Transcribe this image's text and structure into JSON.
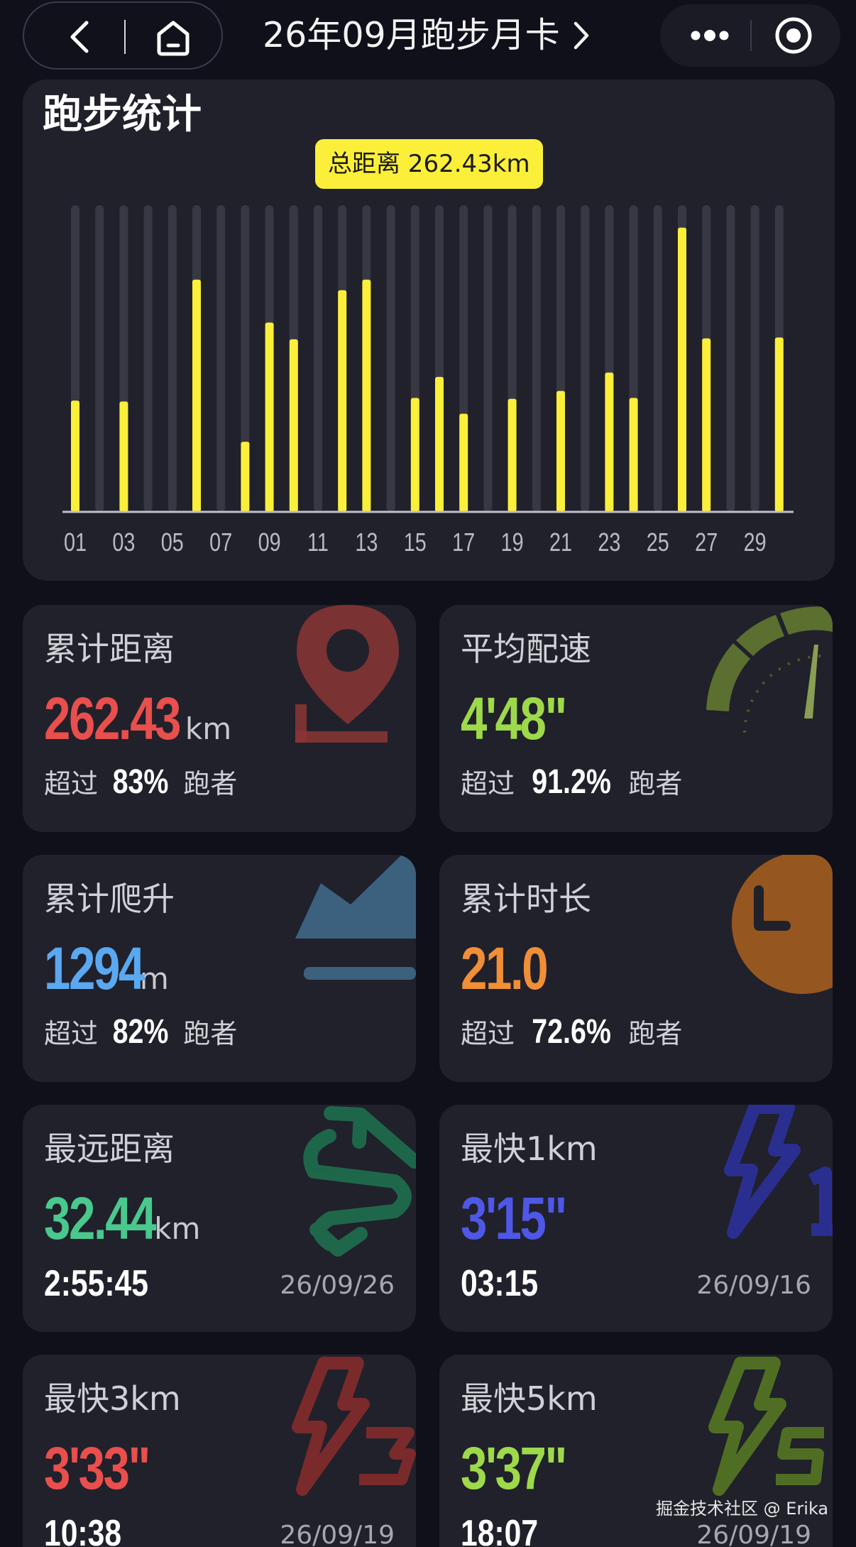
{
  "header": {
    "title": "26年09月跑步月卡",
    "back_icon": "chevron-left-icon",
    "home_icon": "home-icon",
    "more_icon": "more-dots-icon",
    "target_icon": "target-icon"
  },
  "stats_section": {
    "title": "跑步统计",
    "total_label": "总距离 262.43km"
  },
  "chart_data": {
    "type": "bar",
    "x": [
      "01",
      "02",
      "03",
      "04",
      "05",
      "06",
      "07",
      "08",
      "09",
      "10",
      "11",
      "12",
      "13",
      "14",
      "15",
      "16",
      "17",
      "18",
      "19",
      "20",
      "21",
      "22",
      "23",
      "24",
      "25",
      "26",
      "27",
      "28",
      "29",
      "30"
    ],
    "tick_labels": [
      "01",
      "03",
      "05",
      "07",
      "09",
      "11",
      "13",
      "15",
      "17",
      "19",
      "21",
      "23",
      "25",
      "27",
      "29"
    ],
    "values": [
      12.7,
      0,
      12.6,
      0,
      0,
      26.5,
      0,
      8,
      21.6,
      19.7,
      0,
      25.3,
      26.5,
      0,
      13,
      15.4,
      11.2,
      0,
      12.9,
      0,
      13.8,
      0,
      15.9,
      13,
      0,
      32.44,
      19.8,
      0,
      0,
      19.9
    ],
    "ylim": [
      0,
      35
    ],
    "colors": {
      "bar": "#fbef3a",
      "track": "#373843",
      "axis": "#bfc0c6"
    },
    "title": "",
    "xlabel": "",
    "ylabel": ""
  },
  "cards": [
    {
      "id": "total-distance",
      "label": "累计距离",
      "value": "262.43",
      "unit": "km",
      "color": "#e84f4d",
      "sub_prefix": "超过",
      "sub_pct": "83%",
      "sub_suffix": "跑者",
      "icon": "map-pin-icon"
    },
    {
      "id": "avg-pace",
      "label": "平均配速",
      "value": "4'48\"",
      "unit": "",
      "color": "#9ed94a",
      "sub_prefix": "超过",
      "sub_pct": "91.2%",
      "sub_suffix": "跑者",
      "icon": "speedometer-icon"
    },
    {
      "id": "total-climb",
      "label": "累计爬升",
      "value": "1294",
      "unit": "m",
      "color": "#5aa9f0",
      "sub_prefix": "超过",
      "sub_pct": "82%",
      "sub_suffix": "跑者",
      "icon": "mountain-icon"
    },
    {
      "id": "total-duration",
      "label": "累计时长",
      "value": "21.0",
      "unit": "",
      "color": "#f08f36",
      "sub_prefix": "超过",
      "sub_pct": "72.6%",
      "sub_suffix": "跑者",
      "icon": "clock-icon"
    },
    {
      "id": "longest-distance",
      "label": "最远距离",
      "value": "32.44",
      "unit": "km",
      "color": "#49c98d",
      "time": "2:55:45",
      "date": "26/09/26",
      "icon": "route-icon"
    },
    {
      "id": "fastest-1km",
      "label": "最快1km",
      "value": "3'15\"",
      "unit": "",
      "color": "#4f57e6",
      "time": "03:15",
      "date": "26/09/16",
      "icon": "lightning-1-icon"
    },
    {
      "id": "fastest-3km",
      "label": "最快3km",
      "value": "3'33\"",
      "unit": "",
      "color": "#e84f4d",
      "time": "10:38",
      "date": "26/09/19",
      "icon": "lightning-3-icon"
    },
    {
      "id": "fastest-5km",
      "label": "最快5km",
      "value": "3'37\"",
      "unit": "",
      "color": "#9ed94a",
      "time": "18:07",
      "date": "26/09/19",
      "icon": "lightning-5-icon"
    }
  ],
  "watermark": "掘金技术社区 @ Erika"
}
